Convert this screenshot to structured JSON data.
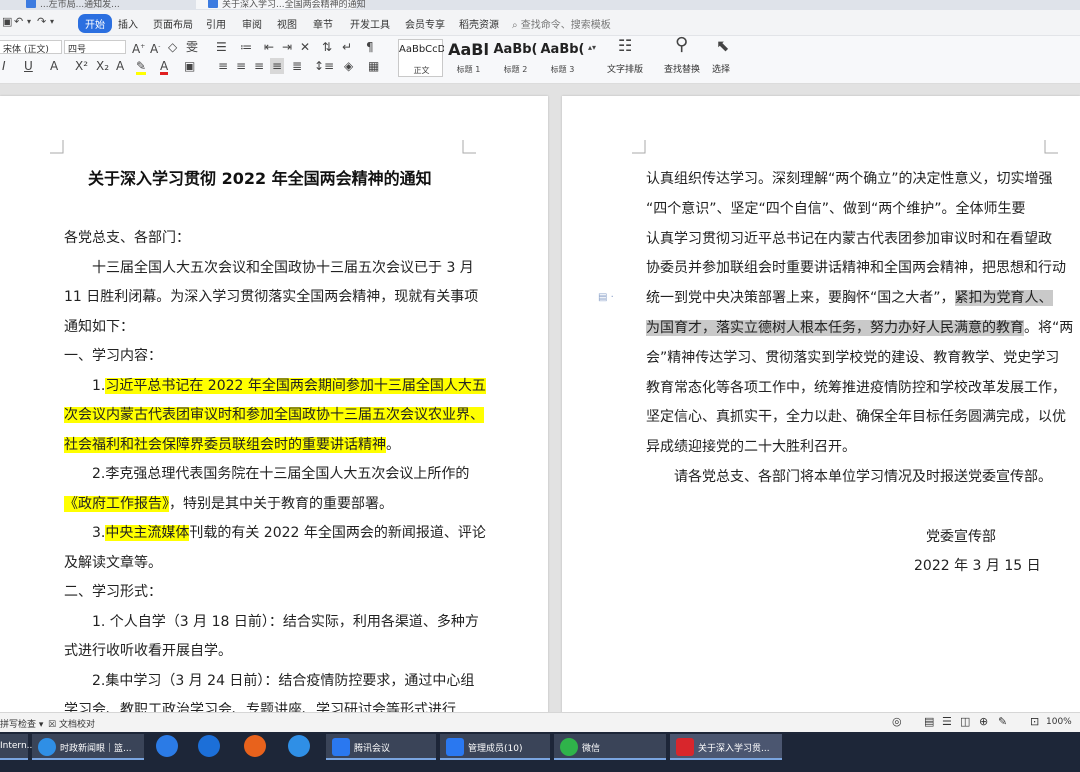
{
  "doc_tabs": [
    "...左市局...通知发...",
    "关于深入学习...全国两会精神的通知"
  ],
  "menu": {
    "items": [
      "开始",
      "插入",
      "页面布局",
      "引用",
      "审阅",
      "视图",
      "章节",
      "开发工具",
      "会员专享",
      "稻壳资源"
    ],
    "active": "开始",
    "search_placeholder": "查找命令、搜索模板"
  },
  "ribbon": {
    "font_name": "宋体 (正文)",
    "font_size": "四号",
    "styles": [
      {
        "preview": "AaBbCcD",
        "label": "正文"
      },
      {
        "preview": "AaBl",
        "label": "标题 1"
      },
      {
        "preview": "AaBb(",
        "label": "标题 2"
      },
      {
        "preview": "AaBb(",
        "label": "标题 3"
      }
    ],
    "tools": [
      "文字排版",
      "查找替换",
      "选择"
    ]
  },
  "page1": {
    "title": "关于深入学习贯彻 2022 年全国两会精神的通知",
    "lines": [
      {
        "segments": [
          {
            "text": "各党总支、各部门："
          }
        ]
      },
      {
        "segments": [
          {
            "text": "十三届全国人大五次会议和全国政协十三届五次会议已于 3 月"
          }
        ]
      },
      {
        "segments": [
          {
            "text": "11 日胜利闭幕。为深入学习贯彻落实全国两会精神，现就有关事项"
          }
        ]
      },
      {
        "segments": [
          {
            "text": "通知如下："
          }
        ]
      },
      {
        "segments": [
          {
            "text": "一、学习内容："
          }
        ]
      },
      {
        "segments": [
          {
            "text": "1."
          },
          {
            "text": "习近平总书记在 2022 年全国两会期间参加十三届全国人大五",
            "hl": "y"
          }
        ]
      },
      {
        "segments": [
          {
            "text": "次会议内蒙古代表团审议时和参加全国政协十三届五次会议农业界、",
            "hl": "y"
          }
        ]
      },
      {
        "segments": [
          {
            "text": "社会福利和社会保障界委员联组会时的重要讲话精神",
            "hl": "y"
          },
          {
            "text": "。"
          }
        ]
      },
      {
        "segments": [
          {
            "text": "2.李克强总理代表国务院在十三届全国人大五次会议上所作的"
          }
        ]
      },
      {
        "segments": [
          {
            "text": "《政府工作报告》",
            "hl": "y"
          },
          {
            "text": "，特别是其中关于教育的重要部署。"
          }
        ]
      },
      {
        "segments": [
          {
            "text": "3."
          },
          {
            "text": "中央主流媒体",
            "hl": "y"
          },
          {
            "text": "刊载的有关 2022 年全国两会的新闻报道、评论"
          }
        ]
      },
      {
        "segments": [
          {
            "text": "及解读文章等。"
          }
        ]
      },
      {
        "segments": [
          {
            "text": "二、学习形式："
          }
        ]
      },
      {
        "segments": [
          {
            "text": "1. 个人自学（3 月 18 日前）：结合实际，利用各渠道、多种方"
          }
        ]
      },
      {
        "segments": [
          {
            "text": "式进行收听收看开展自学。"
          }
        ]
      },
      {
        "segments": [
          {
            "text": "2.集中学习（3 月 24 日前）：结合疫情防控要求，通过中心组"
          }
        ]
      },
      {
        "segments": [
          {
            "text": "学习会、教职工政治学习会、专题讲座、学习研讨会等形式进行"
          }
        ]
      }
    ]
  },
  "page2": {
    "lines": [
      {
        "segments": [
          {
            "text": "认真组织传达学习。深刻理解“两个确立”的决定性意义，切实增强"
          }
        ]
      },
      {
        "segments": [
          {
            "text": "“四个意识”、坚定“四个自信”、做到“两个维护”。全体师生要"
          }
        ]
      },
      {
        "segments": [
          {
            "text": "认真学习贯彻习近平总书记在内蒙古代表团参加审议时和在看望政"
          }
        ]
      },
      {
        "segments": [
          {
            "text": "协委员并参加联组会时重要讲话精神和全国两会精神，把思想和行动"
          }
        ]
      },
      {
        "segments": [
          {
            "text": "统一到党中央决策部署上来，要胸怀“国之大者”，"
          },
          {
            "text": "紧扣为党育人、",
            "hl": "g"
          }
        ]
      },
      {
        "segments": [
          {
            "text": "为国育才，落实立德树人根本任务，努力办好人民满意的教育",
            "hl": "g"
          },
          {
            "text": "。将“两"
          }
        ]
      },
      {
        "segments": [
          {
            "text": "会”精神传达学习、贯彻落实到学校党的建设、教育教学、党史学习"
          }
        ]
      },
      {
        "segments": [
          {
            "text": "教育常态化等各项工作中，统筹推进疫情防控和学校改革发展工作，"
          }
        ]
      },
      {
        "segments": [
          {
            "text": "坚定信心、真抓实干，全力以赴、确保全年目标任务圆满完成，以优"
          }
        ]
      },
      {
        "segments": [
          {
            "text": "异成绩迎接党的二十大胜利召开。"
          }
        ]
      },
      {
        "segments": [
          {
            "text": "请各党总支、各部门将本单位学习情况及时报送党委宣传部。"
          }
        ]
      },
      {
        "segments": [
          {
            "text": ""
          }
        ]
      },
      {
        "segments": [
          {
            "text": "党委宣传部"
          }
        ]
      },
      {
        "segments": [
          {
            "text": "2022 年 3 月 15 日"
          }
        ]
      }
    ]
  },
  "status": {
    "left": [
      "拼写检查",
      "文档校对"
    ],
    "zoom": "100%"
  },
  "taskbar": {
    "items": [
      "时政新闻眼｜篮...",
      "腾讯会议",
      "管理成员(10)",
      "微信",
      "关于深入学习贯..."
    ],
    "left_stub": "Intern..."
  },
  "colors": {
    "highlight_yellow": "#ffff00",
    "highlight_gray": "#c9c9c9",
    "accent": "#2b6fe0"
  }
}
